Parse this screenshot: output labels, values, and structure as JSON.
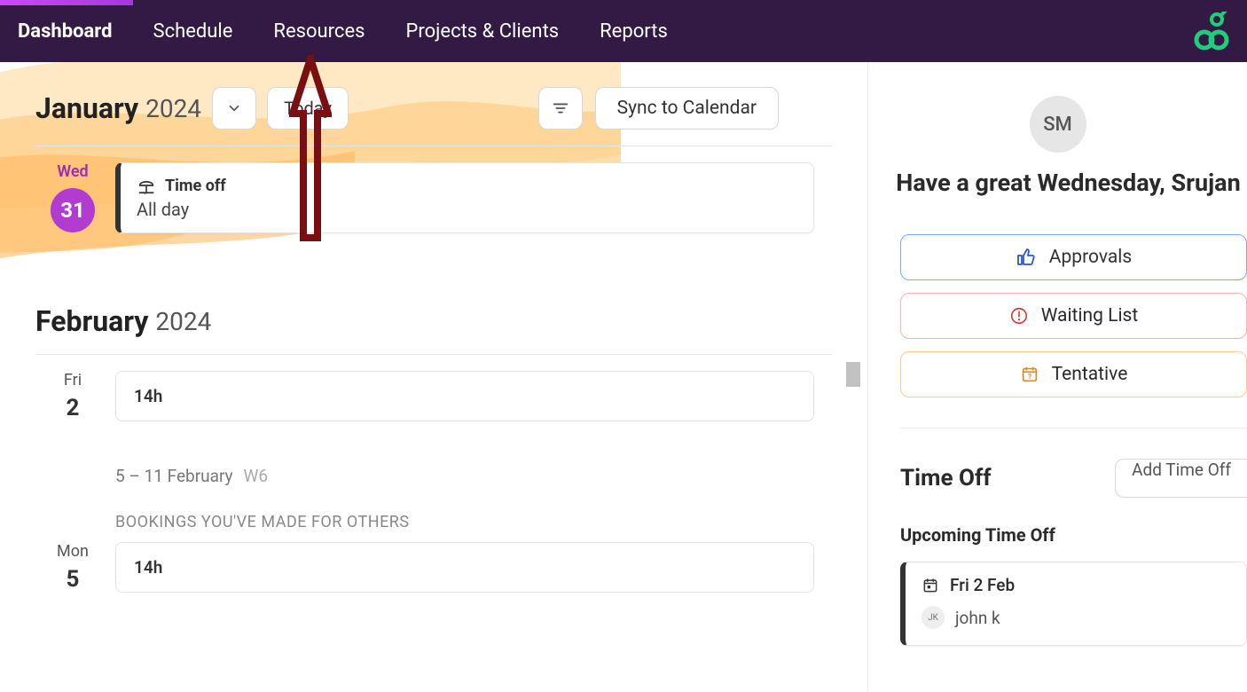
{
  "nav": {
    "items": [
      "Dashboard",
      "Schedule",
      "Resources",
      "Projects & Clients",
      "Reports"
    ],
    "active_index": 0
  },
  "header": {
    "month": "January",
    "year": "2024",
    "today_label": "Today",
    "sync_label": "Sync to Calendar"
  },
  "jan": {
    "day_name": "Wed",
    "day_num": "31",
    "event_title": "Time off",
    "event_sub": "All day"
  },
  "feb_header": {
    "month": "February",
    "year": "2024"
  },
  "feb_fri": {
    "day_name": "Fri",
    "day_num": "2",
    "hours": "14h"
  },
  "week": {
    "range": "5 – 11 February",
    "num": "W6",
    "bookings_label": "BOOKINGS YOU'VE MADE FOR OTHERS"
  },
  "feb_mon": {
    "day_name": "Mon",
    "day_num": "5",
    "hours": "14h"
  },
  "side": {
    "avatar_initials": "SM",
    "greeting": "Have a great Wednesday, Srujan",
    "approvals": "Approvals",
    "waiting": "Waiting List",
    "tentative": "Tentative",
    "timeoff_title": "Time Off",
    "add_timeoff": "Add Time Off",
    "upcoming_label": "Upcoming Time Off",
    "upcoming_date": "Fri 2 Feb",
    "upcoming_person_initials": "JK",
    "upcoming_person": "john k"
  }
}
